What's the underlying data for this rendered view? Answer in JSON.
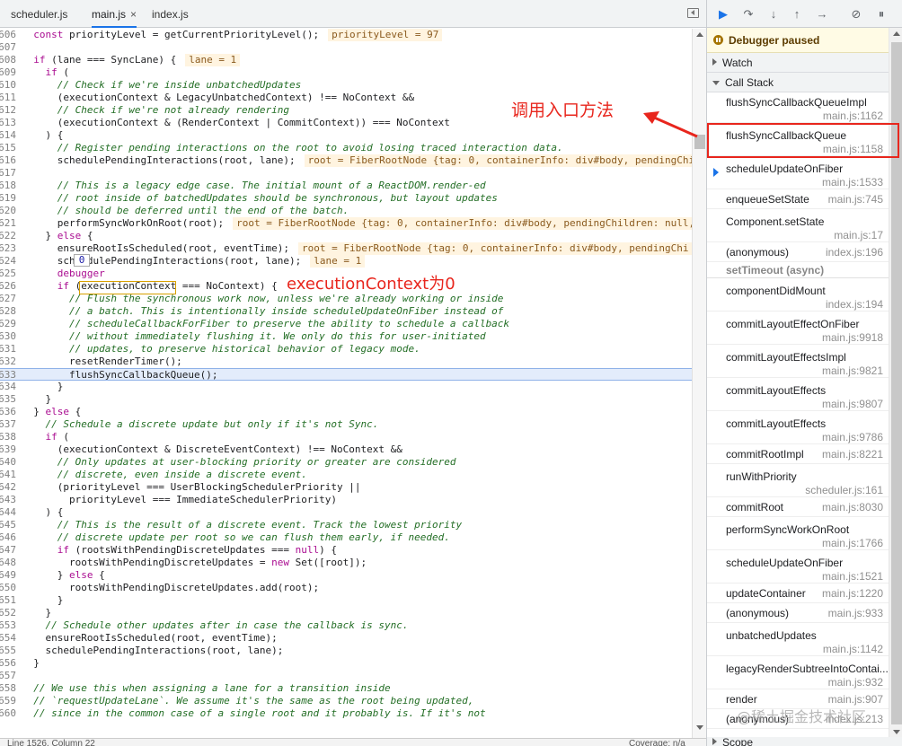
{
  "tabs": [
    {
      "label": "scheduler.js",
      "close": ""
    },
    {
      "label": "main.js",
      "close": "×"
    },
    {
      "label": "index.js",
      "close": ""
    }
  ],
  "code_lines": [
    {
      "n": "606",
      "html": "  <span class='kw'>const</span> priorityLevel = getCurrentPriorityLevel();<span class='inline-val'>priorityLevel = 97</span>"
    },
    {
      "n": "607",
      "html": ""
    },
    {
      "n": "608",
      "html": "  <span class='kw'>if</span> (lane === SyncLane) {<span class='inline-val'>lane = 1</span>"
    },
    {
      "n": "609",
      "html": "    <span class='kw'>if</span> ("
    },
    {
      "n": "610",
      "html": "      <span class='cm'>// Check if we're inside unbatchedUpdates</span>"
    },
    {
      "n": "611",
      "html": "      (executionContext &amp; LegacyUnbatchedContext) !== NoContext &amp;&amp;"
    },
    {
      "n": "612",
      "html": "      <span class='cm'>// Check if we're not already rendering</span>"
    },
    {
      "n": "613",
      "html": "      (executionContext &amp; (RenderContext | CommitContext)) === NoContext"
    },
    {
      "n": "614",
      "html": "    ) {"
    },
    {
      "n": "615",
      "html": "      <span class='cm'>// Register pending interactions on the root to avoid losing traced interaction data.</span>"
    },
    {
      "n": "616",
      "html": "      schedulePendingInteractions(root, lane);<span class='inline-val'>root = FiberRootNode {tag: 0, containerInfo: div#body, pendingChi</span>"
    },
    {
      "n": "617",
      "html": ""
    },
    {
      "n": "618",
      "html": "      <span class='cm'>// This is a legacy edge case. The initial mount of a ReactDOM.render-ed</span>"
    },
    {
      "n": "619",
      "html": "      <span class='cm'>// root inside of batchedUpdates should be synchronous, but layout updates</span>"
    },
    {
      "n": "620",
      "html": "      <span class='cm'>// should be deferred until the end of the batch.</span>"
    },
    {
      "n": "621",
      "html": "      performSyncWorkOnRoot(root);<span class='inline-val'>root = FiberRootNode {tag: 0, containerInfo: div#body, pendingChildren: null,</span>"
    },
    {
      "n": "622",
      "html": "    } <span class='kw'>else</span> {"
    },
    {
      "n": "623",
      "html": "      ensureRootIsScheduled(root, eventTime);<span class='inline-val'>root = FiberRootNode {tag: 0, containerInfo: div#body, pendingChi</span>"
    },
    {
      "n": "624",
      "html": "      sch  dulePendingInteractions(root, lane);<span class='inline-val'>lane = 1</span>"
    },
    {
      "n": "625",
      "html": "      <span class='kw'>debugger</span>"
    },
    {
      "n": "626",
      "html": "      <span class='kw'>if</span> (executionContext === NoContext) {"
    },
    {
      "n": "627",
      "html": "        <span class='cm'>// Flush the synchronous work now, unless we're already working or inside</span>"
    },
    {
      "n": "628",
      "html": "        <span class='cm'>// a batch. This is intentionally inside scheduleUpdateOnFiber instead of</span>"
    },
    {
      "n": "629",
      "html": "        <span class='cm'>// scheduleCallbackForFiber to preserve the ability to schedule a callback</span>"
    },
    {
      "n": "630",
      "html": "        <span class='cm'>// without immediately flushing it. We only do this for user-initiated</span>"
    },
    {
      "n": "631",
      "html": "        <span class='cm'>// updates, to preserve historical behavior of legacy mode.</span>"
    },
    {
      "n": "632",
      "html": "        resetRenderTimer();"
    },
    {
      "n": "633",
      "html": "        flushSyncCallbackQueue();",
      "hl": true
    },
    {
      "n": "634",
      "html": "      }"
    },
    {
      "n": "635",
      "html": "    }"
    },
    {
      "n": "636",
      "html": "  } <span class='kw'>else</span> {"
    },
    {
      "n": "637",
      "html": "    <span class='cm'>// Schedule a discrete update but only if it's not Sync.</span>"
    },
    {
      "n": "638",
      "html": "    <span class='kw'>if</span> ("
    },
    {
      "n": "639",
      "html": "      (executionContext &amp; DiscreteEventContext) !== NoContext &amp;&amp;"
    },
    {
      "n": "640",
      "html": "      <span class='cm'>// Only updates at user-blocking priority or greater are considered</span>"
    },
    {
      "n": "641",
      "html": "      <span class='cm'>// discrete, even inside a discrete event.</span>"
    },
    {
      "n": "642",
      "html": "      (priorityLevel === UserBlockingSchedulerPriority ||"
    },
    {
      "n": "643",
      "html": "        priorityLevel === ImmediateSchedulerPriority)"
    },
    {
      "n": "644",
      "html": "    ) {"
    },
    {
      "n": "645",
      "html": "      <span class='cm'>// This is the result of a discrete event. Track the lowest priority</span>"
    },
    {
      "n": "646",
      "html": "      <span class='cm'>// discrete update per root so we can flush them early, if needed.</span>"
    },
    {
      "n": "647",
      "html": "      <span class='kw'>if</span> (rootsWithPendingDiscreteUpdates === <span class='kw'>null</span>) {"
    },
    {
      "n": "648",
      "html": "        rootsWithPendingDiscreteUpdates = <span class='kw'>new</span> Set([root]);"
    },
    {
      "n": "649",
      "html": "      } <span class='kw'>else</span> {"
    },
    {
      "n": "650",
      "html": "        rootsWithPendingDiscreteUpdates.add(root);"
    },
    {
      "n": "651",
      "html": "      }"
    },
    {
      "n": "652",
      "html": "    }"
    },
    {
      "n": "653",
      "html": "    <span class='cm'>// Schedule other updates after in case the callback is sync.</span>"
    },
    {
      "n": "654",
      "html": "    ensureRootIsScheduled(root, eventTime);"
    },
    {
      "n": "655",
      "html": "    schedulePendingInteractions(root, lane);"
    },
    {
      "n": "656",
      "html": "  }"
    },
    {
      "n": "657",
      "html": ""
    },
    {
      "n": "658",
      "html": "  <span class='cm'>// We use this when assigning a lane for a transition inside</span>"
    },
    {
      "n": "659",
      "html": "  <span class='cm'>// `requestUpdateLane`. We assume it's the same as the root being updated,</span>"
    },
    {
      "n": "660",
      "html": "  <span class='cm'>// since in the common case of a single root and it probably is. If it's not</span>"
    }
  ],
  "hover_tooltip": "0",
  "annotations": {
    "call_entry": "调用入口方法",
    "exec_context": "executionContext为0"
  },
  "statusbar": {
    "position": "Line 1526, Column 22",
    "coverage": "Coverage: n/a"
  },
  "debugger": {
    "paused_label": "Debugger paused",
    "watch_label": "Watch",
    "callstack_label": "Call Stack",
    "scope_label": "Scope"
  },
  "call_stack": [
    {
      "name": "flushSyncCallbackQueueImpl",
      "loc": "main.js:1162"
    },
    {
      "name": "flushSyncCallbackQueue",
      "loc": "main.js:1158"
    },
    {
      "name": "scheduleUpdateOnFiber",
      "loc": "main.js:1533",
      "current": true
    },
    {
      "name": "enqueueSetState",
      "loc": "main.js:745",
      "short": true
    },
    {
      "name": "Component.setState",
      "loc": "main.js:17"
    },
    {
      "name": "(anonymous)",
      "loc": "index.js:196",
      "short": true
    },
    {
      "name": "setTimeout (async)",
      "async": true
    },
    {
      "name": "componentDidMount",
      "loc": "index.js:194"
    },
    {
      "name": "commitLayoutEffectOnFiber",
      "loc": "main.js:9918"
    },
    {
      "name": "commitLayoutEffectsImpl",
      "loc": "main.js:9821"
    },
    {
      "name": "commitLayoutEffects",
      "loc": "main.js:9807"
    },
    {
      "name": "commitLayoutEffects",
      "loc": "main.js:9786"
    },
    {
      "name": "commitRootImpl",
      "loc": "main.js:8221",
      "short": true
    },
    {
      "name": "runWithPriority",
      "loc": "scheduler.js:161"
    },
    {
      "name": "commitRoot",
      "loc": "main.js:8030",
      "short": true
    },
    {
      "name": "performSyncWorkOnRoot",
      "loc": "main.js:1766"
    },
    {
      "name": "scheduleUpdateOnFiber",
      "loc": "main.js:1521"
    },
    {
      "name": "updateContainer",
      "loc": "main.js:1220",
      "short": true
    },
    {
      "name": "(anonymous)",
      "loc": "main.js:933",
      "short": true
    },
    {
      "name": "unbatchedUpdates",
      "loc": "main.js:1142"
    },
    {
      "name": "legacyRenderSubtreeIntoContai...",
      "loc": "main.js:932"
    },
    {
      "name": "render",
      "loc": "main.js:907",
      "short": true
    },
    {
      "name": "(anonymous)",
      "loc": "index.js:213",
      "short": true
    }
  ],
  "watermark": "@稀土掘金技术社区",
  "colors": {
    "accent": "#1a73e8",
    "annotation": "#e8261d",
    "paused_bg": "#fffbe5"
  }
}
